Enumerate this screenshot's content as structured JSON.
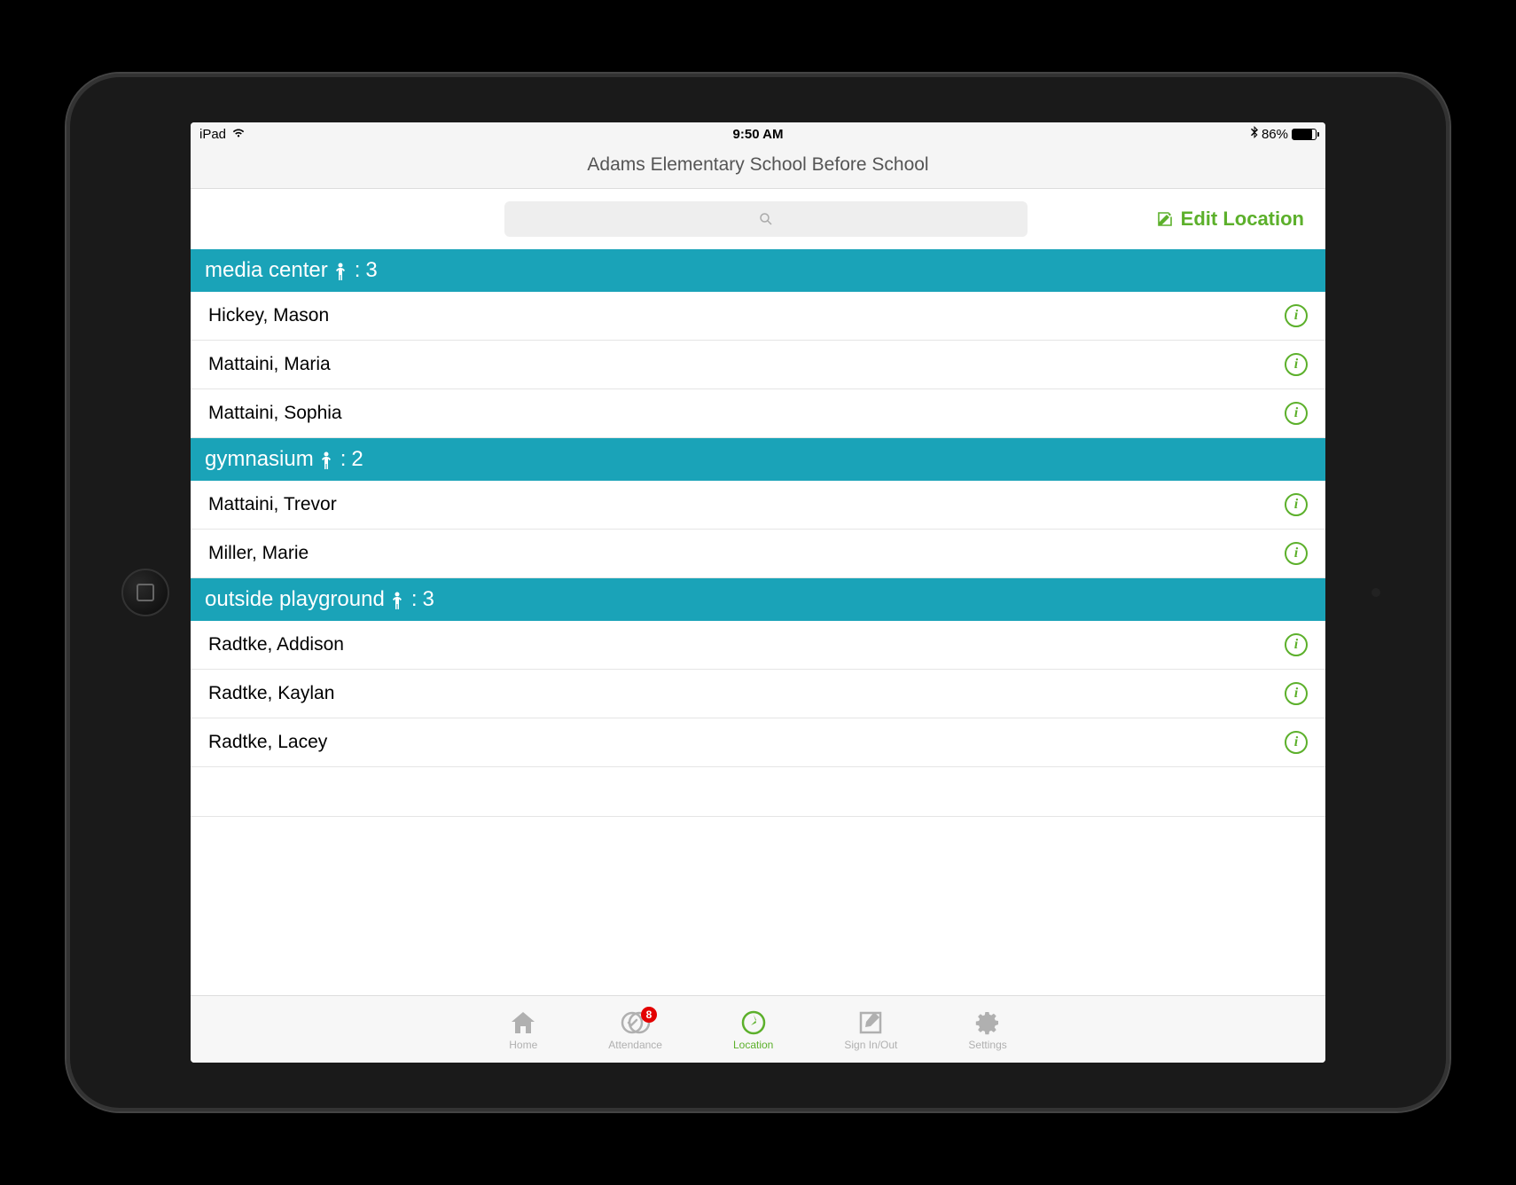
{
  "status": {
    "device": "iPad",
    "time": "9:50 AM",
    "battery_pct": "86%"
  },
  "header": {
    "title": "Adams Elementary School Before School"
  },
  "toolbar": {
    "search_placeholder": "",
    "edit_label": "Edit Location"
  },
  "sections": [
    {
      "name": "media center",
      "count": "3",
      "rows": [
        "Hickey, Mason",
        "Mattaini, Maria",
        "Mattaini, Sophia"
      ]
    },
    {
      "name": "gymnasium",
      "count": "2",
      "rows": [
        "Mattaini, Trevor",
        "Miller, Marie"
      ]
    },
    {
      "name": "outside playground",
      "count": "3",
      "rows": [
        "Radtke, Addison",
        "Radtke, Kaylan",
        "Radtke, Lacey"
      ]
    }
  ],
  "tabs": {
    "home": "Home",
    "attendance": "Attendance",
    "attendance_badge": "8",
    "location": "Location",
    "signinout": "Sign In/Out",
    "settings": "Settings"
  }
}
